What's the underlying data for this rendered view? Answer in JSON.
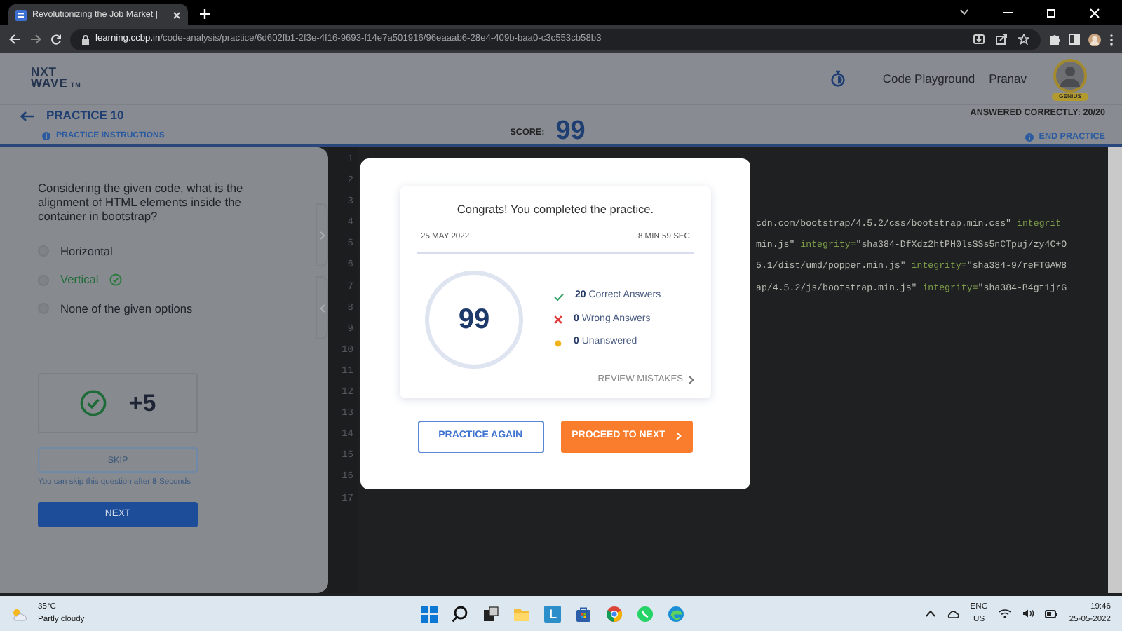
{
  "browser": {
    "tab_title": "Revolutionizing the Job Market |",
    "url_host": "learning.ccbp.in",
    "url_path": "/code-analysis/practice/6d602fb1-2f3e-4f16-9693-f14e7a501916/96eaaab6-28e4-409b-baa0-c3c553cb58b3"
  },
  "header": {
    "logo_top": "NXT",
    "logo_bottom": "WAVE",
    "logo_mark": "TM",
    "nav_link": "Code Playground",
    "user_name": "Pranav",
    "avatar_badge": "GENIUS"
  },
  "subheader": {
    "title": "PRACTICE 10",
    "instructions": "PRACTICE INSTRUCTIONS",
    "score_label": "SCORE:",
    "score": "99",
    "answered": "ANSWERED CORRECTLY: 20/20",
    "end": "END PRACTICE"
  },
  "question": {
    "text": "Considering the given code, what is the alignment of HTML elements inside the container in bootstrap?",
    "options": [
      {
        "label": "Horizontal",
        "selected": false,
        "correct": false
      },
      {
        "label": "Vertical",
        "selected": false,
        "correct": true
      },
      {
        "label": "None of the given options",
        "selected": false,
        "correct": false
      }
    ],
    "result": "+5",
    "skip": {
      "label": "SKIP",
      "disabled": true
    },
    "skip_note": "You can skip this question after **8** Seconds",
    "next": "NEXT"
  },
  "editor": {
    "lines": [
      {
        "number": "1"
      },
      {
        "number": "2"
      },
      {
        "number": "3"
      },
      {
        "number": "4",
        "segments": [
          {
            "kind": "str",
            "text": "cdn.com/bootstrap/4.5.2/css/bootstrap.min.css\""
          },
          {
            "kind": "attr",
            "text": " integrit"
          }
        ]
      },
      {
        "number": "5",
        "segments": [
          {
            "kind": "str",
            "text": "min.js\""
          },
          {
            "kind": "attr",
            "text": " integrity="
          },
          {
            "kind": "str",
            "text": "\"sha384-DfXdz2htPH0lsSSs5nCTpuj/zy4C+O"
          }
        ]
      },
      {
        "number": "6",
        "segments": [
          {
            "kind": "str",
            "text": "5.1/dist/umd/popper.min.js\""
          },
          {
            "kind": "attr",
            "text": " integrity="
          },
          {
            "kind": "str",
            "text": "\"sha384-9/reFTGAW8"
          }
        ]
      },
      {
        "number": "7",
        "segments": [
          {
            "kind": "str",
            "text": "ap/4.5.2/js/bootstrap.min.js\""
          },
          {
            "kind": "attr",
            "text": " integrity="
          },
          {
            "kind": "str",
            "text": "\"sha384-B4gt1jrG"
          }
        ]
      },
      {
        "number": "8"
      },
      {
        "number": "9"
      },
      {
        "number": "10"
      },
      {
        "number": "11"
      },
      {
        "number": "12"
      },
      {
        "number": "13"
      },
      {
        "number": "14"
      },
      {
        "number": "15"
      },
      {
        "number": "16"
      },
      {
        "number": "17"
      }
    ]
  },
  "modal": {
    "title": "Congrats! You completed the practice.",
    "date": "25 MAY 2022",
    "duration": "8 MIN 59 SEC",
    "score": "99",
    "stats": [
      {
        "kind": "correct",
        "count": "20",
        "label": "Correct Answers"
      },
      {
        "kind": "wrong",
        "count": "0",
        "label": "Wrong Answers"
      },
      {
        "kind": "unanswered",
        "count": "0",
        "label": "Unanswered"
      }
    ],
    "review": "REVIEW MISTAKES",
    "buttons": [
      {
        "kind": "outline",
        "label": "PRACTICE AGAIN"
      },
      {
        "kind": "primary",
        "label": "PROCEED TO NEXT"
      }
    ]
  },
  "taskbar": {
    "temperature": "35°C",
    "weather": "Partly cloudy",
    "apps": [
      {
        "kind": "start"
      },
      {
        "kind": "search"
      },
      {
        "kind": "taskview"
      },
      {
        "kind": "folder"
      },
      {
        "kind": "letter",
        "text": "L"
      },
      {
        "kind": "store"
      },
      {
        "kind": "chrome"
      },
      {
        "kind": "whatsapp"
      },
      {
        "kind": "edge"
      }
    ],
    "language": "ENG",
    "region": "US",
    "time": "19:46",
    "date": "25-05-2022"
  }
}
